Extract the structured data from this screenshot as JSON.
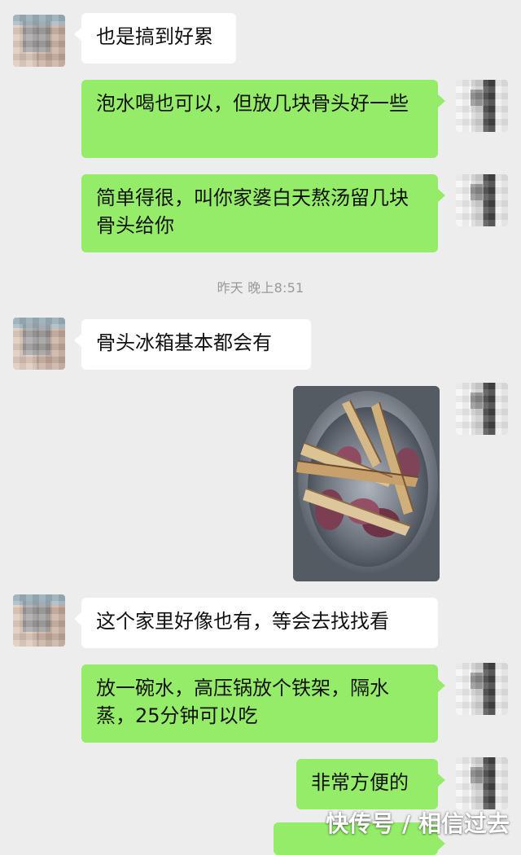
{
  "messages": [
    {
      "side": "left",
      "text": "也是搞到好累"
    },
    {
      "side": "right",
      "text": "泡水喝也可以，但放几块骨头好一些"
    },
    {
      "side": "right",
      "text": "简单得很，叫你家婆白天熬汤留几块骨头给你"
    },
    {
      "side": "left",
      "text": "骨头冰箱基本都会有"
    },
    {
      "side": "left",
      "text": "这个家里好像也有，等会去找找看"
    },
    {
      "side": "right",
      "text": "放一碗水，高压锅放个铁架，隔水蒸，25分钟可以吃"
    },
    {
      "side": "right",
      "text": "非常方便的"
    }
  ],
  "timestamp": "昨天 晚上8:51",
  "watermark": "快传号 / 相信过去",
  "colors": {
    "background": "#ededed",
    "left_bubble": "#ffffff",
    "right_bubble": "#95ec69",
    "timestamp_text": "#999999",
    "watermark_text": "#ffffff"
  },
  "icons": {
    "left_avatar": "blurred-avatar",
    "right_avatar": "blurred-avatar"
  }
}
